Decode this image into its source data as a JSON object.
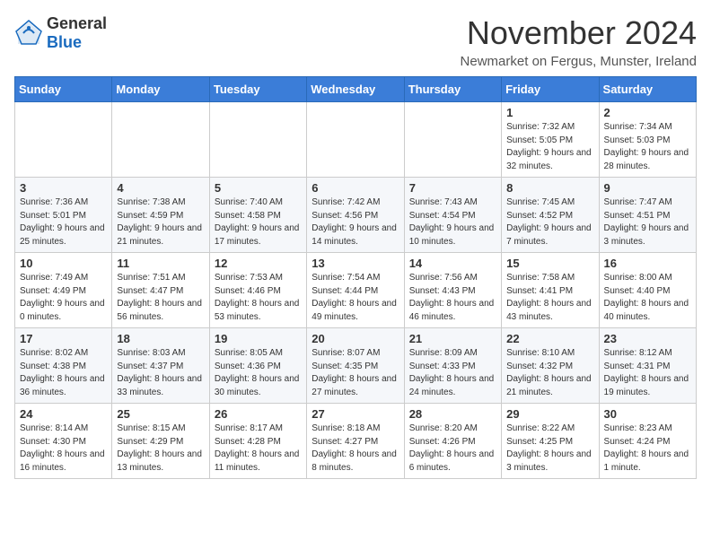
{
  "header": {
    "logo_general": "General",
    "logo_blue": "Blue",
    "title": "November 2024",
    "subtitle": "Newmarket on Fergus, Munster, Ireland"
  },
  "columns": [
    "Sunday",
    "Monday",
    "Tuesday",
    "Wednesday",
    "Thursday",
    "Friday",
    "Saturday"
  ],
  "weeks": [
    {
      "days": [
        {
          "num": "",
          "info": ""
        },
        {
          "num": "",
          "info": ""
        },
        {
          "num": "",
          "info": ""
        },
        {
          "num": "",
          "info": ""
        },
        {
          "num": "",
          "info": ""
        },
        {
          "num": "1",
          "info": "Sunrise: 7:32 AM\nSunset: 5:05 PM\nDaylight: 9 hours and 32 minutes."
        },
        {
          "num": "2",
          "info": "Sunrise: 7:34 AM\nSunset: 5:03 PM\nDaylight: 9 hours and 28 minutes."
        }
      ]
    },
    {
      "days": [
        {
          "num": "3",
          "info": "Sunrise: 7:36 AM\nSunset: 5:01 PM\nDaylight: 9 hours and 25 minutes."
        },
        {
          "num": "4",
          "info": "Sunrise: 7:38 AM\nSunset: 4:59 PM\nDaylight: 9 hours and 21 minutes."
        },
        {
          "num": "5",
          "info": "Sunrise: 7:40 AM\nSunset: 4:58 PM\nDaylight: 9 hours and 17 minutes."
        },
        {
          "num": "6",
          "info": "Sunrise: 7:42 AM\nSunset: 4:56 PM\nDaylight: 9 hours and 14 minutes."
        },
        {
          "num": "7",
          "info": "Sunrise: 7:43 AM\nSunset: 4:54 PM\nDaylight: 9 hours and 10 minutes."
        },
        {
          "num": "8",
          "info": "Sunrise: 7:45 AM\nSunset: 4:52 PM\nDaylight: 9 hours and 7 minutes."
        },
        {
          "num": "9",
          "info": "Sunrise: 7:47 AM\nSunset: 4:51 PM\nDaylight: 9 hours and 3 minutes."
        }
      ]
    },
    {
      "days": [
        {
          "num": "10",
          "info": "Sunrise: 7:49 AM\nSunset: 4:49 PM\nDaylight: 9 hours and 0 minutes."
        },
        {
          "num": "11",
          "info": "Sunrise: 7:51 AM\nSunset: 4:47 PM\nDaylight: 8 hours and 56 minutes."
        },
        {
          "num": "12",
          "info": "Sunrise: 7:53 AM\nSunset: 4:46 PM\nDaylight: 8 hours and 53 minutes."
        },
        {
          "num": "13",
          "info": "Sunrise: 7:54 AM\nSunset: 4:44 PM\nDaylight: 8 hours and 49 minutes."
        },
        {
          "num": "14",
          "info": "Sunrise: 7:56 AM\nSunset: 4:43 PM\nDaylight: 8 hours and 46 minutes."
        },
        {
          "num": "15",
          "info": "Sunrise: 7:58 AM\nSunset: 4:41 PM\nDaylight: 8 hours and 43 minutes."
        },
        {
          "num": "16",
          "info": "Sunrise: 8:00 AM\nSunset: 4:40 PM\nDaylight: 8 hours and 40 minutes."
        }
      ]
    },
    {
      "days": [
        {
          "num": "17",
          "info": "Sunrise: 8:02 AM\nSunset: 4:38 PM\nDaylight: 8 hours and 36 minutes."
        },
        {
          "num": "18",
          "info": "Sunrise: 8:03 AM\nSunset: 4:37 PM\nDaylight: 8 hours and 33 minutes."
        },
        {
          "num": "19",
          "info": "Sunrise: 8:05 AM\nSunset: 4:36 PM\nDaylight: 8 hours and 30 minutes."
        },
        {
          "num": "20",
          "info": "Sunrise: 8:07 AM\nSunset: 4:35 PM\nDaylight: 8 hours and 27 minutes."
        },
        {
          "num": "21",
          "info": "Sunrise: 8:09 AM\nSunset: 4:33 PM\nDaylight: 8 hours and 24 minutes."
        },
        {
          "num": "22",
          "info": "Sunrise: 8:10 AM\nSunset: 4:32 PM\nDaylight: 8 hours and 21 minutes."
        },
        {
          "num": "23",
          "info": "Sunrise: 8:12 AM\nSunset: 4:31 PM\nDaylight: 8 hours and 19 minutes."
        }
      ]
    },
    {
      "days": [
        {
          "num": "24",
          "info": "Sunrise: 8:14 AM\nSunset: 4:30 PM\nDaylight: 8 hours and 16 minutes."
        },
        {
          "num": "25",
          "info": "Sunrise: 8:15 AM\nSunset: 4:29 PM\nDaylight: 8 hours and 13 minutes."
        },
        {
          "num": "26",
          "info": "Sunrise: 8:17 AM\nSunset: 4:28 PM\nDaylight: 8 hours and 11 minutes."
        },
        {
          "num": "27",
          "info": "Sunrise: 8:18 AM\nSunset: 4:27 PM\nDaylight: 8 hours and 8 minutes."
        },
        {
          "num": "28",
          "info": "Sunrise: 8:20 AM\nSunset: 4:26 PM\nDaylight: 8 hours and 6 minutes."
        },
        {
          "num": "29",
          "info": "Sunrise: 8:22 AM\nSunset: 4:25 PM\nDaylight: 8 hours and 3 minutes."
        },
        {
          "num": "30",
          "info": "Sunrise: 8:23 AM\nSunset: 4:24 PM\nDaylight: 8 hours and 1 minute."
        }
      ]
    }
  ]
}
